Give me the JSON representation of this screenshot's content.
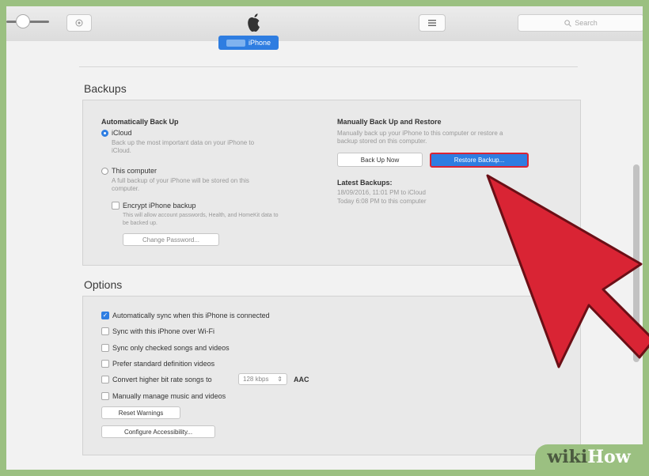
{
  "toolbar": {
    "search_placeholder": "Search",
    "device_tab": "iPhone"
  },
  "backups": {
    "title": "Backups",
    "auto": {
      "heading": "Automatically Back Up",
      "icloud_label": "iCloud",
      "icloud_desc": [
        "Back up the most important data on your iPhone to",
        "iCloud."
      ],
      "computer_label": "This computer",
      "computer_desc": [
        "A full backup of your iPhone will be stored on this",
        "computer."
      ],
      "encrypt_label": "Encrypt iPhone backup",
      "encrypt_desc": [
        "This will allow account passwords, Health, and HomeKit data to",
        "be backed up."
      ],
      "change_password": "Change Password...",
      "selected": "icloud",
      "encrypt_checked": false
    },
    "manual": {
      "heading": "Manually Back Up and Restore",
      "desc": [
        "Manually back up your iPhone to this computer or restore a",
        "backup stored on this computer."
      ],
      "back_up_now": "Back Up Now",
      "restore_backup": "Restore Backup...",
      "latest_heading": "Latest Backups:",
      "latest": [
        "18/09/2016, 11:01 PM to iCloud",
        "Today 6:08 PM to this computer"
      ]
    }
  },
  "options": {
    "title": "Options",
    "items": [
      {
        "label": "Automatically sync when this iPhone is connected",
        "checked": true
      },
      {
        "label": "Sync with this iPhone over Wi-Fi",
        "checked": false
      },
      {
        "label": "Sync only checked songs and videos",
        "checked": false
      },
      {
        "label": "Prefer standard definition videos",
        "checked": false
      },
      {
        "label": "Convert higher bit rate songs to",
        "checked": false
      },
      {
        "label": "Manually manage music and videos",
        "checked": false
      }
    ],
    "bitrate_value": "128 kbps",
    "bitrate_format": "AAC",
    "reset_warnings": "Reset Warnings",
    "configure_accessibility": "Configure Accessibility..."
  },
  "watermark": {
    "part1": "wiki",
    "part2": "How"
  },
  "colors": {
    "accent": "#2e7de1",
    "arrow": "#d92434",
    "frame": "#9bc081"
  },
  "icons": [
    "apple-logo-icon",
    "iphone-icon",
    "list-icon",
    "search-icon",
    "volume-slider",
    "pointer-arrow"
  ]
}
